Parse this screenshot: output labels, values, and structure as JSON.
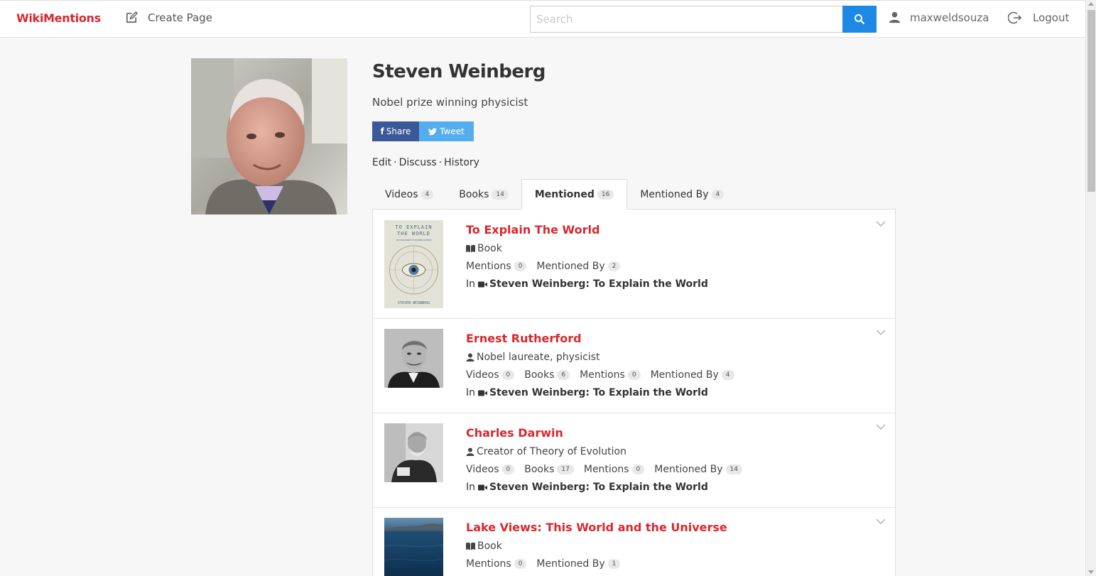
{
  "nav": {
    "brand": "WikiMentions",
    "create_page": "Create Page",
    "search_placeholder": "Search",
    "username": "maxweldsouza",
    "logout": "Logout"
  },
  "profile": {
    "name": "Steven Weinberg",
    "description": "Nobel prize winning physicist",
    "share_label": "Share",
    "tweet_label": "Tweet",
    "edit": "Edit",
    "discuss": "Discuss",
    "history": "History",
    "separator": "·"
  },
  "tabs": [
    {
      "label": "Videos",
      "count": "4"
    },
    {
      "label": "Books",
      "count": "14"
    },
    {
      "label": "Mentioned",
      "count": "16",
      "active": true
    },
    {
      "label": "Mentioned By",
      "count": "4"
    }
  ],
  "items": [
    {
      "title": "To Explain The World",
      "type": "Book",
      "stats": [
        {
          "label": "Mentions",
          "count": "0"
        },
        {
          "label": "Mentioned By",
          "count": "2"
        }
      ],
      "in_label": "In",
      "in_source": "Steven Weinberg: To Explain the World",
      "cover_text": [
        "TO EXPLAIN",
        "THE WORLD",
        "THE DISCOVERY OF MODERN SCIENCE",
        "STEVEN WEINBERG"
      ]
    },
    {
      "title": "Ernest Rutherford",
      "type": "Nobel laureate, physicist",
      "stats": [
        {
          "label": "Videos",
          "count": "0"
        },
        {
          "label": "Books",
          "count": "6"
        },
        {
          "label": "Mentions",
          "count": "0"
        },
        {
          "label": "Mentioned By",
          "count": "4"
        }
      ],
      "in_label": "In",
      "in_source": "Steven Weinberg: To Explain the World"
    },
    {
      "title": "Charles Darwin",
      "type": "Creator of Theory of Evolution",
      "stats": [
        {
          "label": "Videos",
          "count": "0"
        },
        {
          "label": "Books",
          "count": "17"
        },
        {
          "label": "Mentions",
          "count": "0"
        },
        {
          "label": "Mentioned By",
          "count": "14"
        }
      ],
      "in_label": "In",
      "in_source": "Steven Weinberg: To Explain the World"
    },
    {
      "title": "Lake Views: This World and the Universe",
      "type": "Book",
      "stats": [
        {
          "label": "Mentions",
          "count": "0"
        },
        {
          "label": "Mentioned By",
          "count": "1"
        }
      ]
    }
  ],
  "colors": {
    "brand_red": "#d9272e",
    "search_blue": "#1e88e5",
    "facebook_blue": "#3b5998",
    "twitter_blue": "#55acee"
  }
}
